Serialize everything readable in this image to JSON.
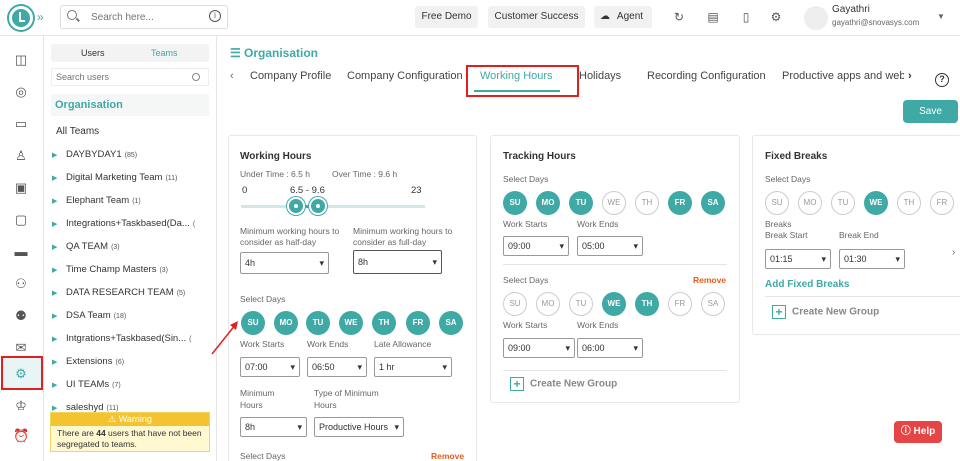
{
  "topbar": {
    "search_placeholder": "Search here...",
    "buttons": [
      "Free Demo",
      "Customer Success",
      "Agent"
    ],
    "user_name": "Gayathri",
    "user_email": "gayathri@snovasys.com"
  },
  "panel": {
    "tab_users": "Users",
    "tab_teams": "Teams",
    "search_placeholder": "Search users",
    "org_heading": "Organisation",
    "all_teams": "All Teams",
    "teams": [
      {
        "name": "DAYBYDAY1",
        "count": "(85)"
      },
      {
        "name": "Digital Marketing Team",
        "count": "(11)"
      },
      {
        "name": "Elephant Team",
        "count": "(1)"
      },
      {
        "name": "Integrations+Taskbased(Da...",
        "count": "("
      },
      {
        "name": "QA TEAM",
        "count": "(3)"
      },
      {
        "name": "Time Champ Masters",
        "count": "(3)"
      },
      {
        "name": "DATA RESEARCH TEAM",
        "count": "(5)"
      },
      {
        "name": "DSA Team",
        "count": "(18)"
      },
      {
        "name": "Intgrations+Taskbased(Sin...",
        "count": "("
      },
      {
        "name": "Extensions",
        "count": "(6)"
      },
      {
        "name": "UI TEAMs",
        "count": "(7)"
      },
      {
        "name": "saleshyd",
        "count": "(11)"
      }
    ],
    "warning_title": "Warning",
    "warning_pre": "There are ",
    "warning_count": "44",
    "warning_post": " users that have not been segregated to teams."
  },
  "main": {
    "title": "Organisation",
    "tabs": [
      "Company Profile",
      "Company Configuration",
      "Working Hours",
      "Holidays",
      "Recording Configuration",
      "Productive apps and web"
    ],
    "active_tab": "Working Hours",
    "save": "Save"
  },
  "working_hours": {
    "title": "Working Hours",
    "under_time": "Under Time : 6.5 h",
    "over_time": "Over Time : 9.6 h",
    "slider_min": "0",
    "slider_range": "6.5 - 9.6",
    "slider_max": "23",
    "slider_value_low": 6.5,
    "slider_value_high": 9.6,
    "half_day_label": "Minimum working hours to consider as half-day",
    "full_day_label": "Minimum working hours to consider as full-day",
    "half_day_value": "4h",
    "full_day_value": "8h",
    "select_days": "Select Days",
    "days": [
      "SU",
      "MO",
      "TU",
      "WE",
      "TH",
      "FR",
      "SA"
    ],
    "work_starts": "Work Starts",
    "work_ends": "Work Ends",
    "late_allowance": "Late Allowance",
    "work_starts_value": "07:00",
    "work_ends_value": "06:50",
    "late_allowance_value": "1 hr",
    "min_hours_label": "Minimum Hours",
    "type_min_label": "Type of Minimum Hours",
    "min_hours_value": "8h",
    "type_min_value": "Productive Hours",
    "select_days_2": "Select Days",
    "remove": "Remove"
  },
  "tracking_hours": {
    "title": "Tracking Hours",
    "select_days": "Select Days",
    "group1_days": [
      {
        "d": "SU",
        "on": true
      },
      {
        "d": "MO",
        "on": true
      },
      {
        "d": "TU",
        "on": true
      },
      {
        "d": "WE",
        "on": false
      },
      {
        "d": "TH",
        "on": false
      },
      {
        "d": "FR",
        "on": true
      },
      {
        "d": "SA",
        "on": true
      }
    ],
    "work_starts": "Work Starts",
    "work_ends": "Work Ends",
    "g1_start": "09:00",
    "g1_end": "05:00",
    "select_days_2": "Select Days",
    "remove": "Remove",
    "group2_days": [
      {
        "d": "SU",
        "on": false
      },
      {
        "d": "MO",
        "on": false
      },
      {
        "d": "TU",
        "on": false
      },
      {
        "d": "WE",
        "on": true
      },
      {
        "d": "TH",
        "on": true
      },
      {
        "d": "FR",
        "on": false
      },
      {
        "d": "SA",
        "on": false
      }
    ],
    "g2_start": "09:00",
    "g2_end": "06:00",
    "create_group": "Create New Group"
  },
  "fixed_breaks": {
    "title": "Fixed Breaks",
    "select_days": "Select Days",
    "days": [
      {
        "d": "SU",
        "on": false
      },
      {
        "d": "MO",
        "on": false
      },
      {
        "d": "TU",
        "on": false
      },
      {
        "d": "WE",
        "on": true
      },
      {
        "d": "TH",
        "on": false
      },
      {
        "d": "FR",
        "on": false
      }
    ],
    "breaks": "Breaks",
    "break_start": "Break Start",
    "break_end": "Break End",
    "break_start_value": "01:15",
    "break_end_value": "01:30",
    "add_fixed": "Add Fixed Breaks",
    "create_group": "Create New Group"
  },
  "help": "Help",
  "colors": {
    "accent": "#3fa9a5",
    "highlight": "#e02020",
    "remove": "#e85c1f",
    "help": "#e64545"
  }
}
